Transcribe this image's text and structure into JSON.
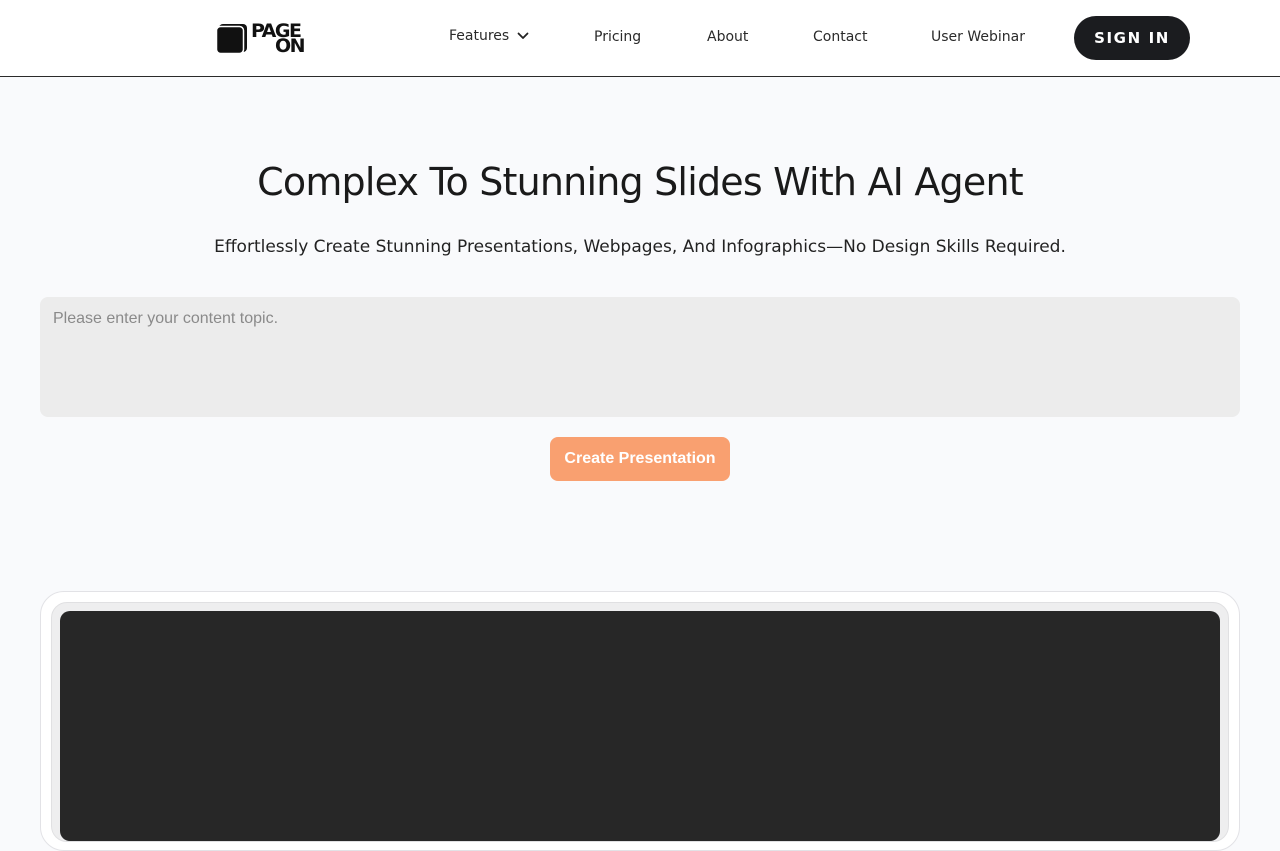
{
  "header": {
    "logo": {
      "line1": "PAGE",
      "line2": "ON"
    },
    "nav": {
      "features": "Features",
      "pricing": "Pricing",
      "about": "About",
      "contact": "Contact",
      "webinar": "User Webinar"
    },
    "signin_label": "SIGN IN"
  },
  "hero": {
    "title": "Complex To Stunning Slides With AI Agent",
    "subtitle": "Effortlessly Create Stunning Presentations, Webpages, And Infographics—No Design Skills Required.",
    "input_placeholder": "Please enter your content topic.",
    "input_value": "",
    "create_label": "Create Presentation"
  },
  "colors": {
    "accent": "#f9a070",
    "dark": "#1b1c1f",
    "preview_bg": "#272727",
    "page_bg": "#f9fafc"
  },
  "icons": {
    "logo": "pageon-logo-icon",
    "features_dropdown": "chevron-down-icon"
  }
}
